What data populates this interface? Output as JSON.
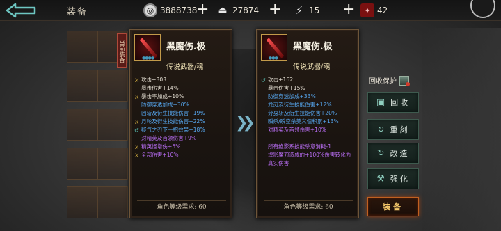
{
  "header": {
    "title": "装备",
    "resources": [
      {
        "icon": "coin-icon",
        "value": "3888738"
      },
      {
        "icon": "ingot-icon",
        "value": "27874"
      },
      {
        "icon": "lightning-icon",
        "value": "15"
      },
      {
        "icon": "red-seal-icon",
        "value": "42"
      }
    ]
  },
  "current_tag": "当前装备",
  "cards": [
    {
      "name": "黑魔伤.极",
      "type": "传说武器/魂",
      "stats": [
        {
          "text": "攻击+303",
          "color": "white",
          "mark": "gold"
        },
        {
          "text": "暴击伤害+14%",
          "color": "white",
          "mark": "none"
        },
        {
          "text": "暴击率加成+10%",
          "color": "white",
          "mark": "gold"
        },
        {
          "text": "防御穿透加成+30%",
          "color": "blue",
          "mark": "none"
        },
        {
          "text": "凶斩及衍生技能伤害+19%",
          "color": "blue",
          "mark": "none"
        },
        {
          "text": "月轮及衍生技能伤害+22%",
          "color": "blue",
          "mark": "gold"
        },
        {
          "text": "疑气之刃下一招效果+18%",
          "color": "blue",
          "mark": "cyan"
        },
        {
          "text": "对精英及首领伤害+9%",
          "color": "purple",
          "mark": "none"
        },
        {
          "text": "精英怪增伤+5%",
          "color": "purple",
          "mark": "gold"
        },
        {
          "text": "全部伤害+10%",
          "color": "purple",
          "mark": "gold"
        }
      ],
      "footer": "角色等级需求: 60"
    },
    {
      "name": "黑魔伤.极",
      "type": "传说武器/魂",
      "stats": [
        {
          "text": "攻击+162",
          "color": "white",
          "mark": "cyan"
        },
        {
          "text": "暴击伤害+15%",
          "color": "white",
          "mark": "none"
        },
        {
          "text": "防御穿透加成+33%",
          "color": "blue",
          "mark": "none"
        },
        {
          "text": "龙刃及衍生技能伤害+12%",
          "color": "blue",
          "mark": "none"
        },
        {
          "text": "分身斩及衍生技能伤害+20%",
          "color": "blue",
          "mark": "none"
        },
        {
          "text": "瞬杀/瞬空杀美义值积累+13%",
          "color": "blue",
          "mark": "none"
        },
        {
          "text": "对精英及首领伤害+10%",
          "color": "purple",
          "mark": "none"
        },
        {
          "text": "",
          "color": "white",
          "mark": "none"
        },
        {
          "text": "所有绝影系技能杀意消耗-1",
          "color": "purple",
          "mark": "none"
        },
        {
          "text": "煌影魔刀造成的+100%伤害转化为",
          "color": "purple",
          "mark": "none"
        },
        {
          "text": "真实伤害",
          "color": "purple",
          "mark": "none"
        }
      ],
      "footer": "角色等级需求: 60"
    }
  ],
  "actions": {
    "protect_label": "回收保护",
    "recycle": "回收",
    "reforge": "重刻",
    "modify": "改造",
    "strengthen": "强化",
    "equip": "装备"
  }
}
